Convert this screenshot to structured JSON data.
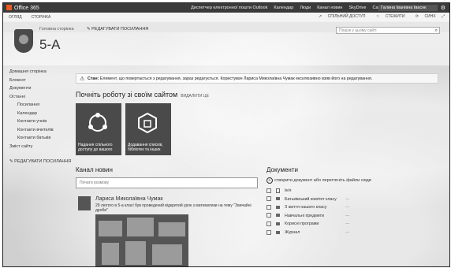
{
  "topbar": {
    "brand": "Office 365",
    "nav": [
      "Диспетчер електронної пошти Outlook",
      "Календар",
      "Люди",
      "Канал новин",
      "SkyDrive",
      "Сайти",
      "..."
    ],
    "user": "Галина Іванівна Іваснк"
  },
  "suite": {
    "left": [
      "ОГЛЯД",
      "СТОРІНКА"
    ],
    "share": "СПІЛЬНИЙ ДОСТУП",
    "follow": "СТЕЖИТИ",
    "sync": "СИНХ"
  },
  "header": {
    "home_link": "Головна сторінка",
    "edit_links": "РЕДАГУВАТИ ПОСИЛАННЯ",
    "title": "5-А",
    "search_placeholder": "Пошук у цьому сайті"
  },
  "leftnav": {
    "items": [
      {
        "label": "Домашня сторінка",
        "sub": false
      },
      {
        "label": "Блокнот",
        "sub": false
      },
      {
        "label": "Документи",
        "sub": false
      },
      {
        "label": "Останні",
        "sub": false
      },
      {
        "label": "Посилання",
        "sub": true
      },
      {
        "label": "Календар",
        "sub": true
      },
      {
        "label": "Контакти учнів",
        "sub": true
      },
      {
        "label": "Контакти вчителів",
        "sub": true
      },
      {
        "label": "Контакти батьків",
        "sub": true
      },
      {
        "label": "Зміст сайту",
        "sub": false
      }
    ],
    "edit": "РЕДАГУВАТИ ПОСИЛАННЯ"
  },
  "status": {
    "label": "Стан:",
    "text": "Елемент, що повертається з редагування, зараз редагується. Користувач Лариса Миколаївна Чумак ексклюзивно взяв його на редагування."
  },
  "start": {
    "heading": "Почніть роботу зі своїм сайтом",
    "remove": "ВИДАЛИТИ ЦЕ",
    "tiles": [
      {
        "label": "Надання спільного доступу до вашого"
      },
      {
        "label": "Додавання списків, бібліотек та інших"
      }
    ]
  },
  "news": {
    "heading": "Канал новин",
    "placeholder": "Почати розмову",
    "author": "Лариса Миколаївна Чумак",
    "text": "29 лютого в 5-а класі був проведений відкритий урок з математики на тему \"Звичайні дроби\""
  },
  "docs": {
    "heading": "Документи",
    "upload": "створити документ або перетягніть файли сюди",
    "header": "Ім'я",
    "items": [
      "Батьківський комітет класу",
      "З життя нашого класу",
      "Навчальні предмети",
      "Корисні програми",
      "Журнал"
    ]
  },
  "icons": {
    "share": "share-icon",
    "follow": "star-icon",
    "sync": "sync-icon",
    "search": "search-icon",
    "edit": "pencil-icon",
    "warning": "warning-icon"
  }
}
